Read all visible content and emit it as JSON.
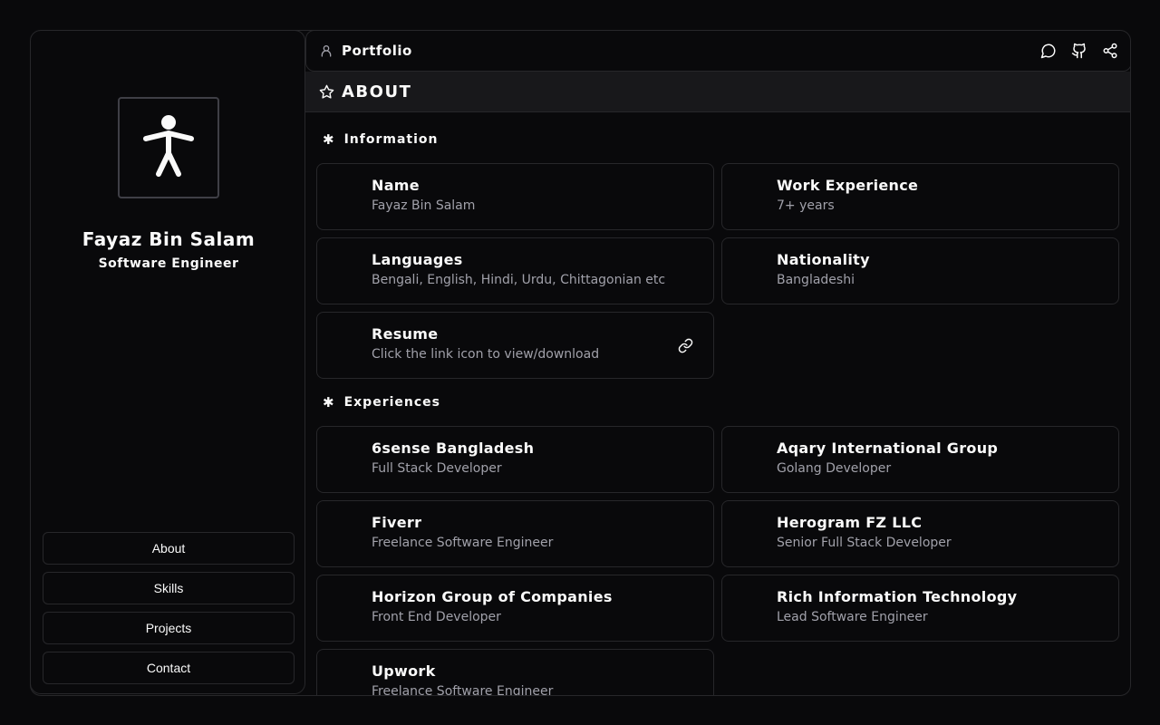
{
  "profile": {
    "name": "Fayaz Bin Salam",
    "title": "Software Engineer",
    "avatar_icon": "accessibility-figure-icon"
  },
  "nav": [
    {
      "label": "About"
    },
    {
      "label": "Skills"
    },
    {
      "label": "Projects"
    },
    {
      "label": "Contact"
    }
  ],
  "topbar": {
    "brand": "Portfolio",
    "brand_icon": "user-icon",
    "actions": [
      "message-icon",
      "github-icon",
      "share-icon"
    ]
  },
  "section": {
    "title": "ABOUT",
    "icon": "star-icon"
  },
  "information": {
    "heading": "Information",
    "items": [
      {
        "title": "Name",
        "value": "Fayaz Bin Salam"
      },
      {
        "title": "Work Experience",
        "value": "7+ years"
      },
      {
        "title": "Languages",
        "value": "Bengali, English, Hindi, Urdu, Chittagonian etc"
      },
      {
        "title": "Nationality",
        "value": "Bangladeshi"
      },
      {
        "title": "Resume",
        "value": "Click the link icon to view/download"
      }
    ]
  },
  "experiences": {
    "heading": "Experiences",
    "items": [
      {
        "company": "6sense Bangladesh",
        "role": "Full Stack Developer"
      },
      {
        "company": "Aqary International Group",
        "role": "Golang Developer"
      },
      {
        "company": "Fiverr",
        "role": "Freelance Software Engineer"
      },
      {
        "company": "Herogram FZ LLC",
        "role": "Senior Full Stack Developer"
      },
      {
        "company": "Horizon Group of Companies",
        "role": "Front End Developer"
      },
      {
        "company": "Rich Information Technology",
        "role": "Lead Software Engineer"
      },
      {
        "company": "Upwork",
        "role": "Freelance Software Engineer"
      }
    ]
  },
  "colors": {
    "background": "#09090b",
    "border": "#27272a",
    "muted_text": "#a1a1aa",
    "header_bg": "#18181b"
  }
}
